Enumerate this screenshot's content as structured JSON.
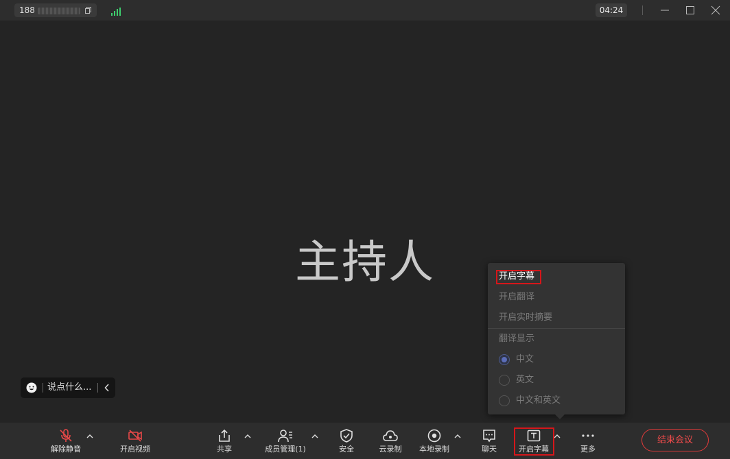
{
  "titlebar": {
    "meeting_id_prefix": "188",
    "timer": "04:24"
  },
  "main": {
    "host_name": "主持人"
  },
  "quick_chat": {
    "placeholder": "说点什么..."
  },
  "caption_menu": {
    "items": [
      {
        "label": "开启字幕",
        "enabled": true
      },
      {
        "label": "开启翻译",
        "enabled": false
      },
      {
        "label": "开启实时摘要",
        "enabled": false
      }
    ],
    "section_title": "翻译显示",
    "options": [
      {
        "label": "中文",
        "selected": true
      },
      {
        "label": "英文",
        "selected": false
      },
      {
        "label": "中文和英文",
        "selected": false
      }
    ]
  },
  "toolbar": {
    "unmute": "解除静音",
    "start_video": "开启视频",
    "share": "共享",
    "members": "成员管理(1)",
    "security": "安全",
    "cloud_record": "云录制",
    "local_record": "本地录制",
    "chat": "聊天",
    "captions": "开启字幕",
    "more": "更多",
    "end_meeting": "结束会议"
  },
  "colors": {
    "background": "#242424",
    "toolbar": "#2d2d2d",
    "alert_red": "#e03a3a",
    "highlight_box": "#d6161a",
    "radio_selected": "#5b6db8",
    "signal_green": "#3ecf6e"
  }
}
